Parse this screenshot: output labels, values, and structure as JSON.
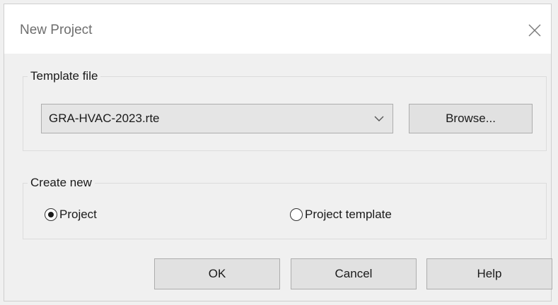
{
  "window": {
    "title": "New Project",
    "close_icon": "close-icon"
  },
  "template_group": {
    "label": "Template file",
    "selected_file": "GRA-HVAC-2023.rte",
    "dropdown_icon": "chevron-down-icon",
    "browse_label": "Browse..."
  },
  "create_group": {
    "label": "Create new",
    "options": [
      {
        "label": "Project",
        "selected": true
      },
      {
        "label": "Project template",
        "selected": false
      }
    ]
  },
  "buttons": {
    "ok": "OK",
    "cancel": "Cancel",
    "help": "Help"
  }
}
